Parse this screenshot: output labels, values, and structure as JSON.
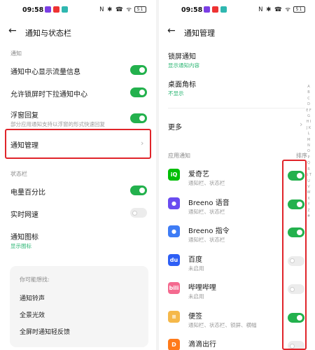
{
  "left": {
    "status_time": "09:58",
    "status_icons": "N ✱ ☎ ᯤ",
    "battery": "51",
    "title": "通知与状态栏",
    "section_notify": "通知",
    "row_traffic": "通知中心显示流量信息",
    "row_lockpull": "允许锁屏时下拉通知中心",
    "row_float": "浮窗回复",
    "row_float_sub": "部分应用通知支持以浮窗的形式快速回复",
    "row_manage": "通知管理",
    "section_statusbar": "状态栏",
    "row_battery": "电量百分比",
    "row_speed": "实时网速",
    "row_icon": "通知图标",
    "row_icon_sub": "显示图标",
    "tips_title": "你可能想找:",
    "tips": [
      "通知铃声",
      "全景光效",
      "全屏时通知轻反馈"
    ],
    "toggles": {
      "traffic": "on",
      "lockpull": "on",
      "float": "on",
      "battery": "on",
      "speed": "off"
    }
  },
  "right": {
    "status_time": "09:58",
    "status_icons": "N ✱ ☎ ᯤ",
    "battery": "51",
    "title": "通知管理",
    "lock_title": "锁屏通知",
    "lock_sub": "显示通知内容",
    "badge_title": "桌面角标",
    "badge_sub": "不显示",
    "more": "更多",
    "section_apps": "应用通知",
    "sort": "排序",
    "alphabet": "A B C D E F G H I J K L M N O P Q R S T U V W X Y Z #",
    "apps": [
      {
        "name": "爱奇艺",
        "sub": "通知栏、状态栏",
        "icon": "iqiyi-icon",
        "color": "#00be06",
        "glyph": "iQ",
        "toggle": "on"
      },
      {
        "name": "Breeno 语音",
        "sub": "通知栏、状态栏",
        "icon": "breeno-voice-icon",
        "color": "#6a4cf0",
        "glyph": "●",
        "toggle": "on"
      },
      {
        "name": "Breeno 指令",
        "sub": "通知栏、状态栏",
        "icon": "breeno-command-icon",
        "color": "#3e7cf5",
        "glyph": "●",
        "toggle": "on"
      },
      {
        "name": "百度",
        "sub": "未启用",
        "icon": "baidu-icon",
        "color": "#2e5ff5",
        "glyph": "du",
        "toggle": "off"
      },
      {
        "name": "哔哩哔哩",
        "sub": "未启用",
        "icon": "bilibili-icon",
        "color": "#f46a8f",
        "glyph": "bili",
        "toggle": "off"
      },
      {
        "name": "便签",
        "sub": "通知栏、状态栏、锁屏、横幅",
        "icon": "notes-icon",
        "color": "#f5b84a",
        "glyph": "≡",
        "toggle": "on"
      },
      {
        "name": "滴滴出行",
        "sub": "",
        "icon": "didi-icon",
        "color": "#ff7a1a",
        "glyph": "D",
        "toggle": "off"
      }
    ]
  }
}
